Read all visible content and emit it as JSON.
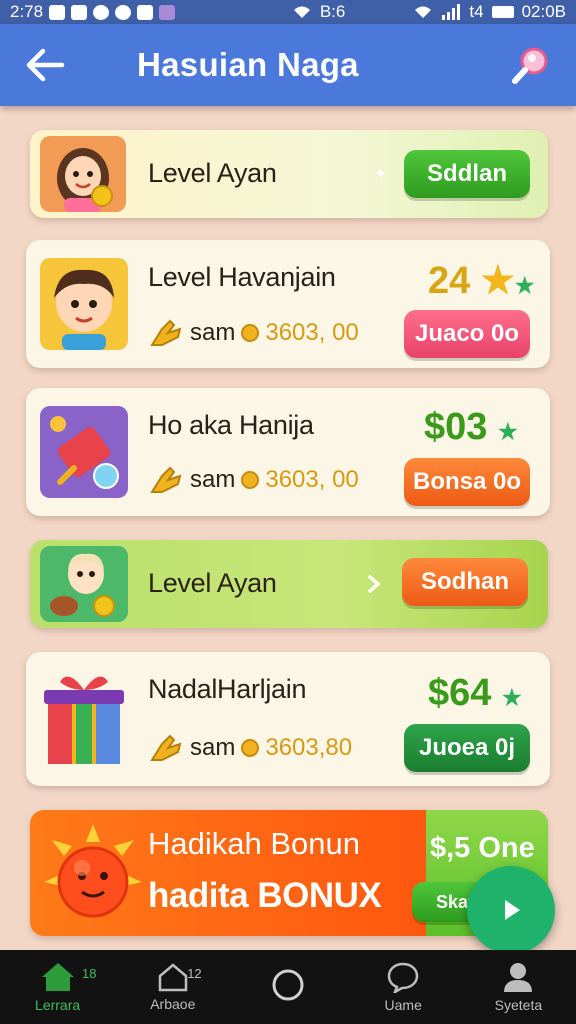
{
  "status_bar": {
    "time": "2:78",
    "right_time": "02:0B",
    "signal_text": "B:6",
    "network_text": "t4"
  },
  "app_bar": {
    "title": "Hasuian Naga"
  },
  "cards": [
    {
      "title": "Level Ayan",
      "button": "Sddlan"
    },
    {
      "title": "Level Havanjain",
      "value": "24",
      "reward_label": "sam",
      "reward_amount": "3603, 00",
      "button": "Juaco 0o"
    },
    {
      "title": "Ho aka Hanija",
      "value": "$03",
      "reward_label": "sam",
      "reward_amount": "3603, 00",
      "button": "Bonsa 0o"
    },
    {
      "title": "Level Ayan",
      "button": "Sodhan"
    },
    {
      "title": "NadalHarljain",
      "value": "$64",
      "reward_label": "sam",
      "reward_amount": "3603,80",
      "button": "Juoea 0j"
    }
  ],
  "bonus_card": {
    "title": "Hadikah Bonun",
    "subtitle_prefix": "hadita",
    "subtitle_highlight": "BONUX",
    "value": "$,5 One",
    "button": "Skat"
  },
  "bottom_nav": [
    {
      "label": "Lerrara",
      "badge": "18",
      "active": true
    },
    {
      "label": "Arbaoe",
      "badge": "12",
      "active": false
    },
    {
      "label": "",
      "badge": "",
      "active": false
    },
    {
      "label": "Uame",
      "badge": "",
      "active": false
    },
    {
      "label": "Syeteta",
      "badge": "",
      "active": false
    }
  ],
  "colors": {
    "app_bar": "#4a78db",
    "status_bar": "#3f5fa8",
    "background": "#f2d6c6",
    "accent_green": "#2e9b1f",
    "value_gold": "#d9a514",
    "value_green": "#3a9a1a"
  },
  "icons": {
    "back": "arrow-left-icon",
    "search": "search-icon",
    "fab": "play-icon"
  }
}
